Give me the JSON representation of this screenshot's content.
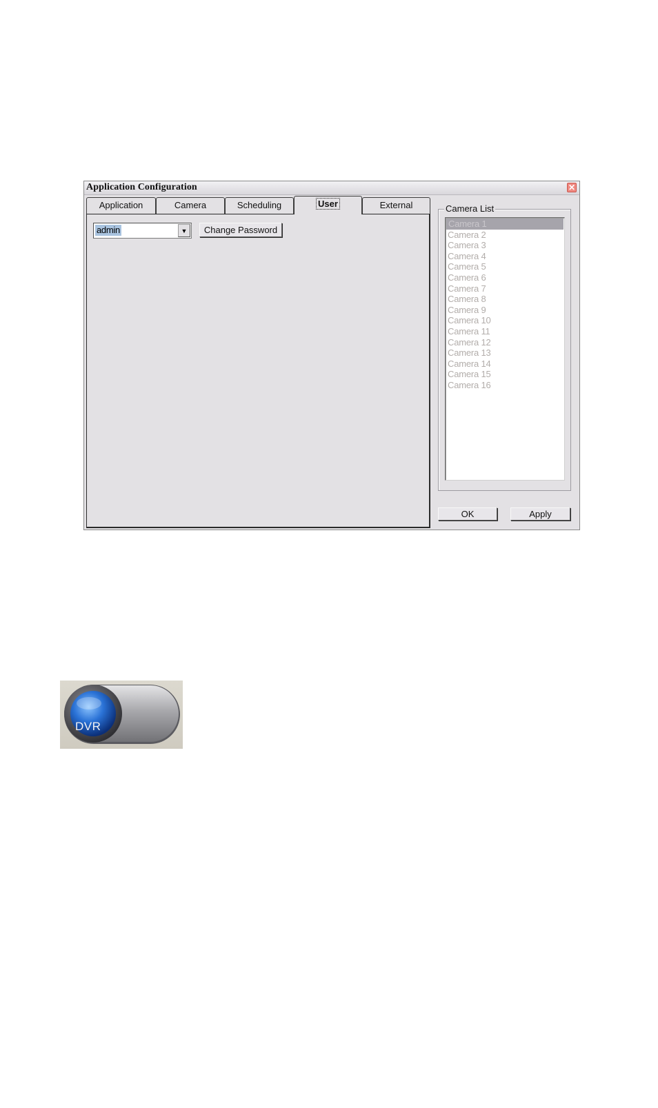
{
  "window": {
    "title": "Application Configuration",
    "close_glyph": "✕"
  },
  "tabs": [
    {
      "label": "Application"
    },
    {
      "label": "Camera"
    },
    {
      "label": "Scheduling"
    },
    {
      "label": "User",
      "active": true
    },
    {
      "label": "External"
    }
  ],
  "user_tab": {
    "user_select_value": "admin",
    "dropdown_glyph": "▼",
    "change_password_label": "Change Password"
  },
  "camera_list": {
    "label": "Camera List",
    "items": [
      "Camera 1",
      "Camera 2",
      "Camera 3",
      "Camera 4",
      "Camera 5",
      "Camera 6",
      "Camera 7",
      "Camera 8",
      "Camera 9",
      "Camera 10",
      "Camera 11",
      "Camera 12",
      "Camera 13",
      "Camera 14",
      "Camera 15",
      "Camera 16"
    ],
    "selected_index": 0
  },
  "buttons": {
    "ok_label": "OK",
    "apply_label": "Apply"
  },
  "dvr_logo": {
    "text": "DVR",
    "icon": "dvr-globe-icon"
  }
}
